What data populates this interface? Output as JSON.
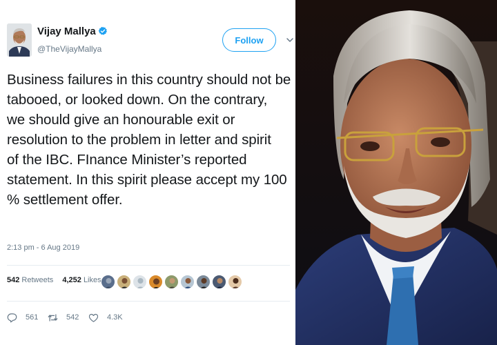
{
  "tweet": {
    "author_name": "Vijay Mallya",
    "handle": "@TheVijayMallya",
    "follow_label": "Follow",
    "text_lines": [
      "Business failures in this country should not be",
      "tabooed, or looked down. On the contrary,",
      "we should give an honourable exit or",
      "resolution to the problem in letter and spirit",
      "of the IBC. FInance Minister’s reported",
      "statement. In this spirit please accept my 100",
      "% settlement offer."
    ],
    "timestamp": "2:13 pm - 6 Aug 2019",
    "retweets_count": "542",
    "retweets_label": "Retweets",
    "likes_count": "4,252",
    "likes_label": "Likes",
    "replies": "561",
    "retweets_action": "542",
    "likes_action": "4.3K"
  },
  "icons": {
    "verified": "verified-badge-icon",
    "caret": "chevron-down-icon",
    "reply": "reply-icon",
    "retweet": "retweet-icon",
    "like": "heart-icon"
  },
  "colors": {
    "accent": "#1da1f2",
    "text": "#14171a",
    "muted": "#657786",
    "divider": "#e6ecf0"
  }
}
